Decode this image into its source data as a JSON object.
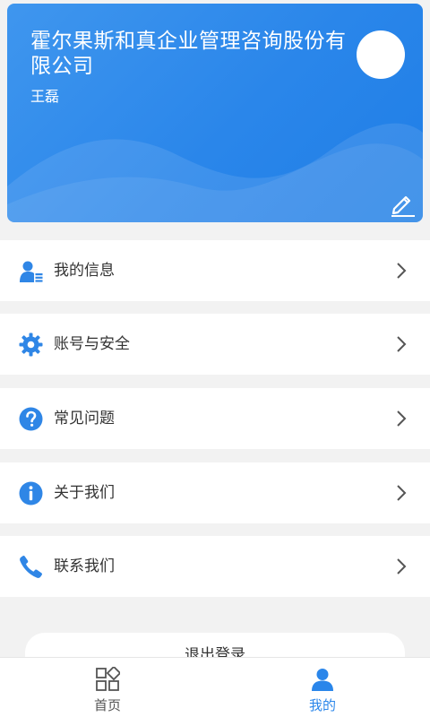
{
  "profile": {
    "company": "霍尔果斯和真企业管理咨询股份有限公司",
    "user": "王磊"
  },
  "menu": [
    {
      "label": "我的信息",
      "icon": "user-info-icon"
    },
    {
      "label": "账号与安全",
      "icon": "gear-icon"
    },
    {
      "label": "常见问题",
      "icon": "question-icon"
    },
    {
      "label": "关于我们",
      "icon": "info-icon"
    },
    {
      "label": "联系我们",
      "icon": "phone-icon"
    }
  ],
  "logout_label": "退出登录",
  "nav": {
    "home_label": "首页",
    "mine_label": "我的"
  },
  "colors": {
    "accent": "#2a86ea",
    "icon_blue": "#2f86e6",
    "nav_inactive": "#555555",
    "nav_active": "#2a86ea"
  }
}
